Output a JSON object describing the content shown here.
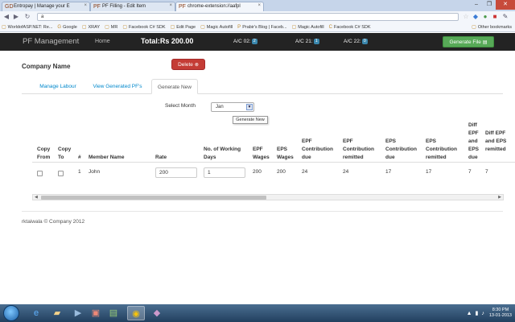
{
  "browser": {
    "tabs": [
      {
        "icon": "GD",
        "title": "Entropay | Manage your E"
      },
      {
        "icon": "PF",
        "title": "PF Filling - Edit Item"
      },
      {
        "icon": "PF",
        "title": "chrome-extension://aafpl"
      }
    ],
    "window_controls": [
      "–",
      "❐",
      "✕"
    ],
    "url": "a",
    "bookmarks": [
      {
        "icon": "▢",
        "label": "WorldofASP.NET: Re..."
      },
      {
        "icon": "G",
        "label": "Google"
      },
      {
        "icon": "▢",
        "label": "XRAY"
      },
      {
        "icon": "▢",
        "label": "MR"
      },
      {
        "icon": "▢",
        "label": "Facebook C# SDK"
      },
      {
        "icon": "▢",
        "label": "Edit Page"
      },
      {
        "icon": "▢",
        "label": "Magic Autofill"
      },
      {
        "icon": "P",
        "label": "Prabir's Blog | Faceb..."
      },
      {
        "icon": "▢",
        "label": "Magic Autofill"
      },
      {
        "icon": "C",
        "label": "Facebook C# SDK"
      }
    ],
    "other_bookmarks": "Other bookmarks"
  },
  "navbar": {
    "brand": "PF Management",
    "home": "Home",
    "total": "Total:Rs 200.00",
    "accounts": [
      {
        "label": "A/C 02:",
        "count": "2"
      },
      {
        "label": "A/C 21:",
        "count": "1"
      },
      {
        "label": "A/C 22:",
        "count": "0"
      }
    ],
    "generate_file": "Generate File"
  },
  "company": {
    "name": "Company Name",
    "delete": "Delete"
  },
  "tabs": [
    "Manage Labour",
    "View Generated PF's",
    "Generate New"
  ],
  "month": {
    "label": "Select Month",
    "value": "Jan",
    "tooltip": "Generate New"
  },
  "table": {
    "headers": {
      "copy_from": [
        "Copy",
        "From"
      ],
      "copy_to": [
        "Copy",
        "To"
      ],
      "num": [
        "#"
      ],
      "member": [
        "Member Name"
      ],
      "rate": [
        "Rate"
      ],
      "days": [
        "No. of Working",
        "Days"
      ],
      "epf_wages": [
        "EPF",
        "Wages"
      ],
      "eps_wages": [
        "EPS",
        "Wages"
      ],
      "epf_due": [
        "EPF",
        "Contribution",
        "due"
      ],
      "epf_remitted": [
        "EPF",
        "Contribution",
        "remitted"
      ],
      "eps_due": [
        "EPS",
        "Contribution",
        "due"
      ],
      "eps_remitted": [
        "EPS",
        "Contribution",
        "remitted"
      ],
      "diff_due": [
        "Diff",
        "EPF",
        "and",
        "EPS",
        "due"
      ],
      "diff_remitted": [
        "Diff EPF",
        "and EPS",
        "remitted"
      ]
    },
    "row": {
      "num": "1",
      "member": "John",
      "rate": "200",
      "days": "1",
      "epf_wages": "200",
      "eps_wages": "200",
      "epf_due": "24",
      "epf_remitted": "24",
      "eps_due": "17",
      "eps_remitted": "17",
      "diff_due": "7",
      "diff_remitted": "7"
    }
  },
  "footer": "rktaiwala © Company 2012",
  "taskbar": {
    "time": "8:30 PM",
    "date": "13-01-2013"
  }
}
